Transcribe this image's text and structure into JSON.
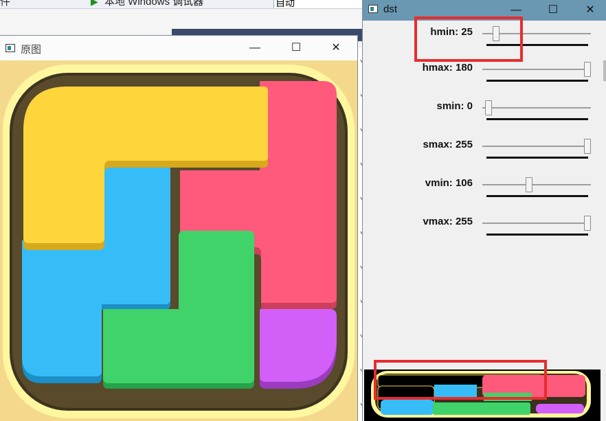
{
  "background_ide": {
    "toolbar": {
      "left_fragment": "件",
      "debugger_label": "本地 Windows 调试器",
      "config_value": "自动"
    }
  },
  "src_window": {
    "title": "原图",
    "icon": "image-window-icon",
    "controls": [
      "minimize-icon",
      "maximize-icon",
      "close-icon"
    ]
  },
  "dst_window": {
    "title": "dst",
    "icon": "image-window-icon",
    "controls": [
      "minimize-icon",
      "maximize-icon",
      "close-icon"
    ],
    "trackbars": [
      {
        "name": "hmin",
        "label": "hmin: 25",
        "value": 25,
        "max": 180
      },
      {
        "name": "hmax",
        "label": "hmax: 180",
        "value": 180,
        "max": 180
      },
      {
        "name": "smin",
        "label": "smin: 0",
        "value": 0,
        "max": 255
      },
      {
        "name": "smax",
        "label": "smax: 255",
        "value": 255,
        "max": 255
      },
      {
        "name": "vmin",
        "label": "vmin: 106",
        "value": 106,
        "max": 255
      },
      {
        "name": "vmax",
        "label": "vmax: 255",
        "value": 255,
        "max": 255
      }
    ]
  },
  "colors": {
    "highlight": "#e62d2d",
    "puzzle_yellow": "#ffd53c",
    "puzzle_pink": "#ff5a7c",
    "puzzle_blue": "#36bdf7",
    "puzzle_green": "#3fd36a",
    "puzzle_purple": "#d25ff7",
    "frame": "#fff59a",
    "board": "#4a3f26"
  }
}
